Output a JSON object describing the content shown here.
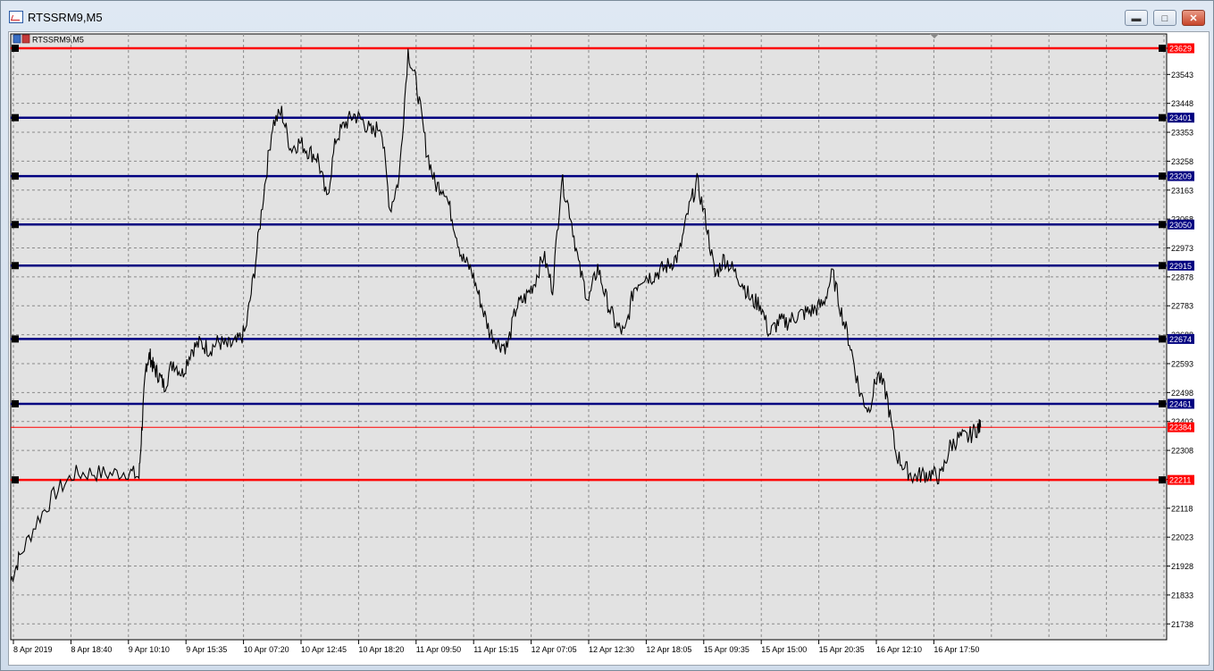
{
  "window": {
    "title": "RTSSRM9,M5",
    "buttons": {
      "minimize": "▬",
      "maximize": "□",
      "close": "✕"
    }
  },
  "chart_data": {
    "type": "line",
    "title": "RTSSRM9,M5",
    "symbol": "RTSSRM9,M5",
    "grid": true,
    "ylim": [
      21686,
      23676
    ],
    "y_ticks": [
      23629,
      23543,
      23448,
      23353,
      23258,
      23163,
      23068,
      22973,
      22878,
      22783,
      22688,
      22593,
      22498,
      22403,
      22308,
      22213,
      22118,
      22023,
      21928,
      21833,
      21738
    ],
    "x_ticks": [
      "8 Apr 2019",
      "8 Apr 18:40",
      "9 Apr 10:10",
      "9 Apr 15:35",
      "10 Apr 07:20",
      "10 Apr 12:45",
      "10 Apr 18:20",
      "11 Apr 09:50",
      "11 Apr 15:15",
      "12 Apr 07:05",
      "12 Apr 12:30",
      "12 Apr 18:05",
      "15 Apr 09:35",
      "15 Apr 15:00",
      "15 Apr 20:35",
      "16 Apr 12:10",
      "16 Apr 17:50"
    ],
    "price_series": {
      "color": "#000000",
      "points": [
        [
          0,
          21880
        ],
        [
          1,
          21960
        ],
        [
          3,
          22080
        ],
        [
          5,
          22170
        ],
        [
          7,
          22230
        ],
        [
          9,
          22235
        ],
        [
          11,
          22230
        ],
        [
          13,
          22240
        ],
        [
          14.2,
          22220
        ],
        [
          14.6,
          22420
        ],
        [
          15,
          22590
        ],
        [
          15.4,
          22620
        ],
        [
          15.8,
          22580
        ],
        [
          16.3,
          22560
        ],
        [
          17,
          22520
        ],
        [
          18,
          22600
        ],
        [
          19,
          22560
        ],
        [
          20,
          22640
        ],
        [
          21,
          22660
        ],
        [
          22,
          22640
        ],
        [
          23,
          22665
        ],
        [
          24,
          22650
        ],
        [
          25,
          22660
        ],
        [
          26,
          22700
        ],
        [
          27,
          22900
        ],
        [
          28,
          23150
        ],
        [
          29,
          23380
        ],
        [
          30,
          23420
        ],
        [
          31,
          23300
        ],
        [
          32,
          23320
        ],
        [
          33,
          23290
        ],
        [
          34,
          23270
        ],
        [
          35,
          23130
        ],
        [
          36,
          23330
        ],
        [
          37,
          23380
        ],
        [
          38,
          23410
        ],
        [
          39,
          23390
        ],
        [
          40,
          23350
        ],
        [
          41,
          23380
        ],
        [
          42,
          23100
        ],
        [
          43,
          23200
        ],
        [
          44,
          23620
        ],
        [
          45,
          23500
        ],
        [
          46,
          23300
        ],
        [
          47,
          23180
        ],
        [
          48,
          23170
        ],
        [
          49,
          23060
        ],
        [
          50,
          22940
        ],
        [
          51,
          22900
        ],
        [
          52,
          22800
        ],
        [
          53,
          22700
        ],
        [
          54,
          22660
        ],
        [
          55,
          22650
        ],
        [
          56,
          22780
        ],
        [
          57,
          22810
        ],
        [
          58,
          22860
        ],
        [
          59,
          22950
        ],
        [
          60,
          22840
        ],
        [
          61,
          23200
        ],
        [
          62,
          23080
        ],
        [
          63,
          22900
        ],
        [
          64,
          22800
        ],
        [
          65,
          22910
        ],
        [
          66,
          22800
        ],
        [
          67,
          22720
        ],
        [
          68,
          22690
        ],
        [
          69,
          22840
        ],
        [
          70,
          22880
        ],
        [
          71,
          22880
        ],
        [
          72,
          22900
        ],
        [
          73,
          22920
        ],
        [
          74,
          22950
        ],
        [
          75,
          23090
        ],
        [
          76,
          23190
        ],
        [
          77,
          23060
        ],
        [
          78,
          22880
        ],
        [
          79,
          22940
        ],
        [
          80,
          22900
        ],
        [
          81,
          22860
        ],
        [
          82,
          22800
        ],
        [
          83,
          22790
        ],
        [
          84,
          22690
        ],
        [
          85,
          22730
        ],
        [
          86,
          22730
        ],
        [
          87,
          22750
        ],
        [
          88,
          22760
        ],
        [
          89,
          22770
        ],
        [
          90,
          22790
        ],
        [
          91,
          22890
        ],
        [
          92,
          22760
        ],
        [
          93,
          22650
        ],
        [
          94,
          22500
        ],
        [
          95,
          22440
        ],
        [
          96,
          22560
        ],
        [
          97,
          22490
        ],
        [
          98,
          22300
        ],
        [
          99,
          22250
        ],
        [
          100,
          22220
        ],
        [
          101,
          22230
        ],
        [
          102,
          22230
        ],
        [
          103,
          22220
        ],
        [
          104,
          22320
        ],
        [
          105,
          22350
        ],
        [
          106,
          22350
        ],
        [
          107,
          22380
        ],
        [
          107.4,
          22384
        ]
      ]
    },
    "levels": [
      {
        "value": 23629,
        "label": "23629",
        "color": "#ff0000"
      },
      {
        "value": 23401,
        "label": "23401",
        "color": "#000080"
      },
      {
        "value": 23209,
        "label": "23209",
        "color": "#000080"
      },
      {
        "value": 23050,
        "label": "23050",
        "color": "#000080"
      },
      {
        "value": 22915,
        "label": "22915",
        "color": "#000080"
      },
      {
        "value": 22674,
        "label": "22674",
        "color": "#000080"
      },
      {
        "value": 22461,
        "label": "22461",
        "color": "#000080"
      },
      {
        "value": 22211,
        "label": "22211",
        "color": "#ff0000"
      }
    ],
    "current_price": {
      "value": 22384,
      "label": "22384",
      "color": "#ff0000"
    }
  }
}
